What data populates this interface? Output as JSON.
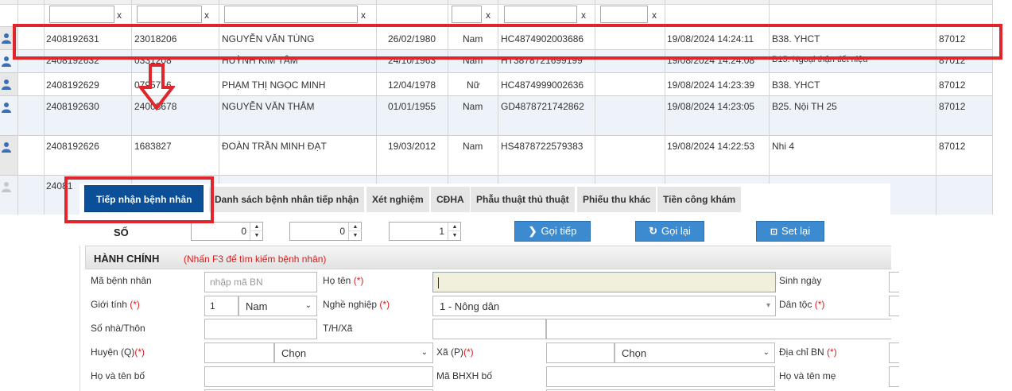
{
  "grid": {
    "rows": [
      {
        "ma_bn": "2408192631",
        "so_the": "23018206",
        "ho_ten": "NGUYỄN VĂN TÙNG",
        "ngay_sinh": "26/02/1980",
        "gioi_tinh": "Nam",
        "bhyt": "HC4874902003686",
        "thoi_gian": "19/08/2024 14:24:11",
        "khoa": "B38. YHCT",
        "ma": "87012"
      },
      {
        "ma_bn": "2408192632",
        "so_the": "0331208",
        "ho_ten": "HUỲNH KIM TÂM",
        "ngay_sinh": "24/10/1963",
        "gioi_tinh": "Nam",
        "bhyt": "HT3878721699199",
        "thoi_gian": "19/08/2024 14:24:08",
        "khoa": "B15. Ngoại thận tiết niệu",
        "ma": "87012"
      },
      {
        "ma_bn": "2408192629",
        "so_the": "0795716",
        "ho_ten": "PHẠM THỊ NGỌC MINH",
        "ngay_sinh": "12/04/1978",
        "gioi_tinh": "Nữ",
        "bhyt": "HC4874999002636",
        "thoi_gian": "19/08/2024 14:23:39",
        "khoa": "B38. YHCT",
        "ma": "87012"
      },
      {
        "ma_bn": "2408192630",
        "so_the": "24008678",
        "ho_ten": "NGUYỄN VĂN THẮM",
        "ngay_sinh": "01/01/1955",
        "gioi_tinh": "Nam",
        "bhyt": "GD4878721742862",
        "thoi_gian": "19/08/2024 14:23:05",
        "khoa": "B25. Nội TH 25",
        "ma": "87012"
      },
      {
        "ma_bn": "2408192626",
        "so_the": "1683827",
        "ho_ten": "ĐOÀN TRẦN MINH ĐẠT",
        "ngay_sinh": "19/03/2012",
        "gioi_tinh": "Nam",
        "bhyt": "HS4878722579383",
        "thoi_gian": "19/08/2024 14:22:53",
        "khoa": "Nhi 4",
        "ma": "87012"
      },
      {
        "ma_bn": "24081"
      }
    ],
    "filter_clear": "x"
  },
  "tabs": [
    {
      "label": "Tiếp nhận bệnh nhân"
    },
    {
      "label": "Danh sách bệnh nhân tiếp nhận"
    },
    {
      "label": "Xét nghiệm"
    },
    {
      "label": "CĐHA"
    },
    {
      "label": "Phẫu thuật thủ thuật"
    },
    {
      "label": "Phiếu thu khác"
    },
    {
      "label": "Tiền công khám"
    }
  ],
  "so": {
    "label": "SỐ",
    "values": [
      "0",
      "0",
      "1"
    ]
  },
  "buttons": {
    "goi_tiep": "Gọi tiếp",
    "goi_lai": "Gọi lại",
    "set_lai": "Set lại"
  },
  "hanh_chinh": {
    "title": "HÀNH CHÍNH",
    "hint": "(Nhấn F3 để tìm kiếm bệnh nhân)",
    "ma_bn_label": "Mã bệnh nhân",
    "ma_bn_placeholder": "nhập mã BN",
    "ho_ten_label": "Họ tên",
    "sinh_ngay_label": "Sinh ngày",
    "gioi_tinh_label": "Giới tính",
    "gioi_tinh_code": "1",
    "gioi_tinh_value": "Nam",
    "nghe_nghiep_label": "Nghề nghiệp",
    "nghe_nghiep_value": "1 - Nông dân",
    "dan_toc_label": "Dân tộc",
    "so_nha_label": "Số nhà/Thôn",
    "thxa_label": "T/H/Xã",
    "huyen_label": "Huyện (Q)",
    "huyen_value": "Chọn",
    "xa_label": "Xã (P)",
    "xa_value": "Chọn",
    "dia_chi_label": "Địa chỉ BN",
    "ho_ten_bo_label": "Họ và tên bố",
    "bhxh_bo_label": "Mã BHXH bố",
    "ho_ten_me_label": "Họ và tên mẹ",
    "required_mark": "(*)"
  }
}
